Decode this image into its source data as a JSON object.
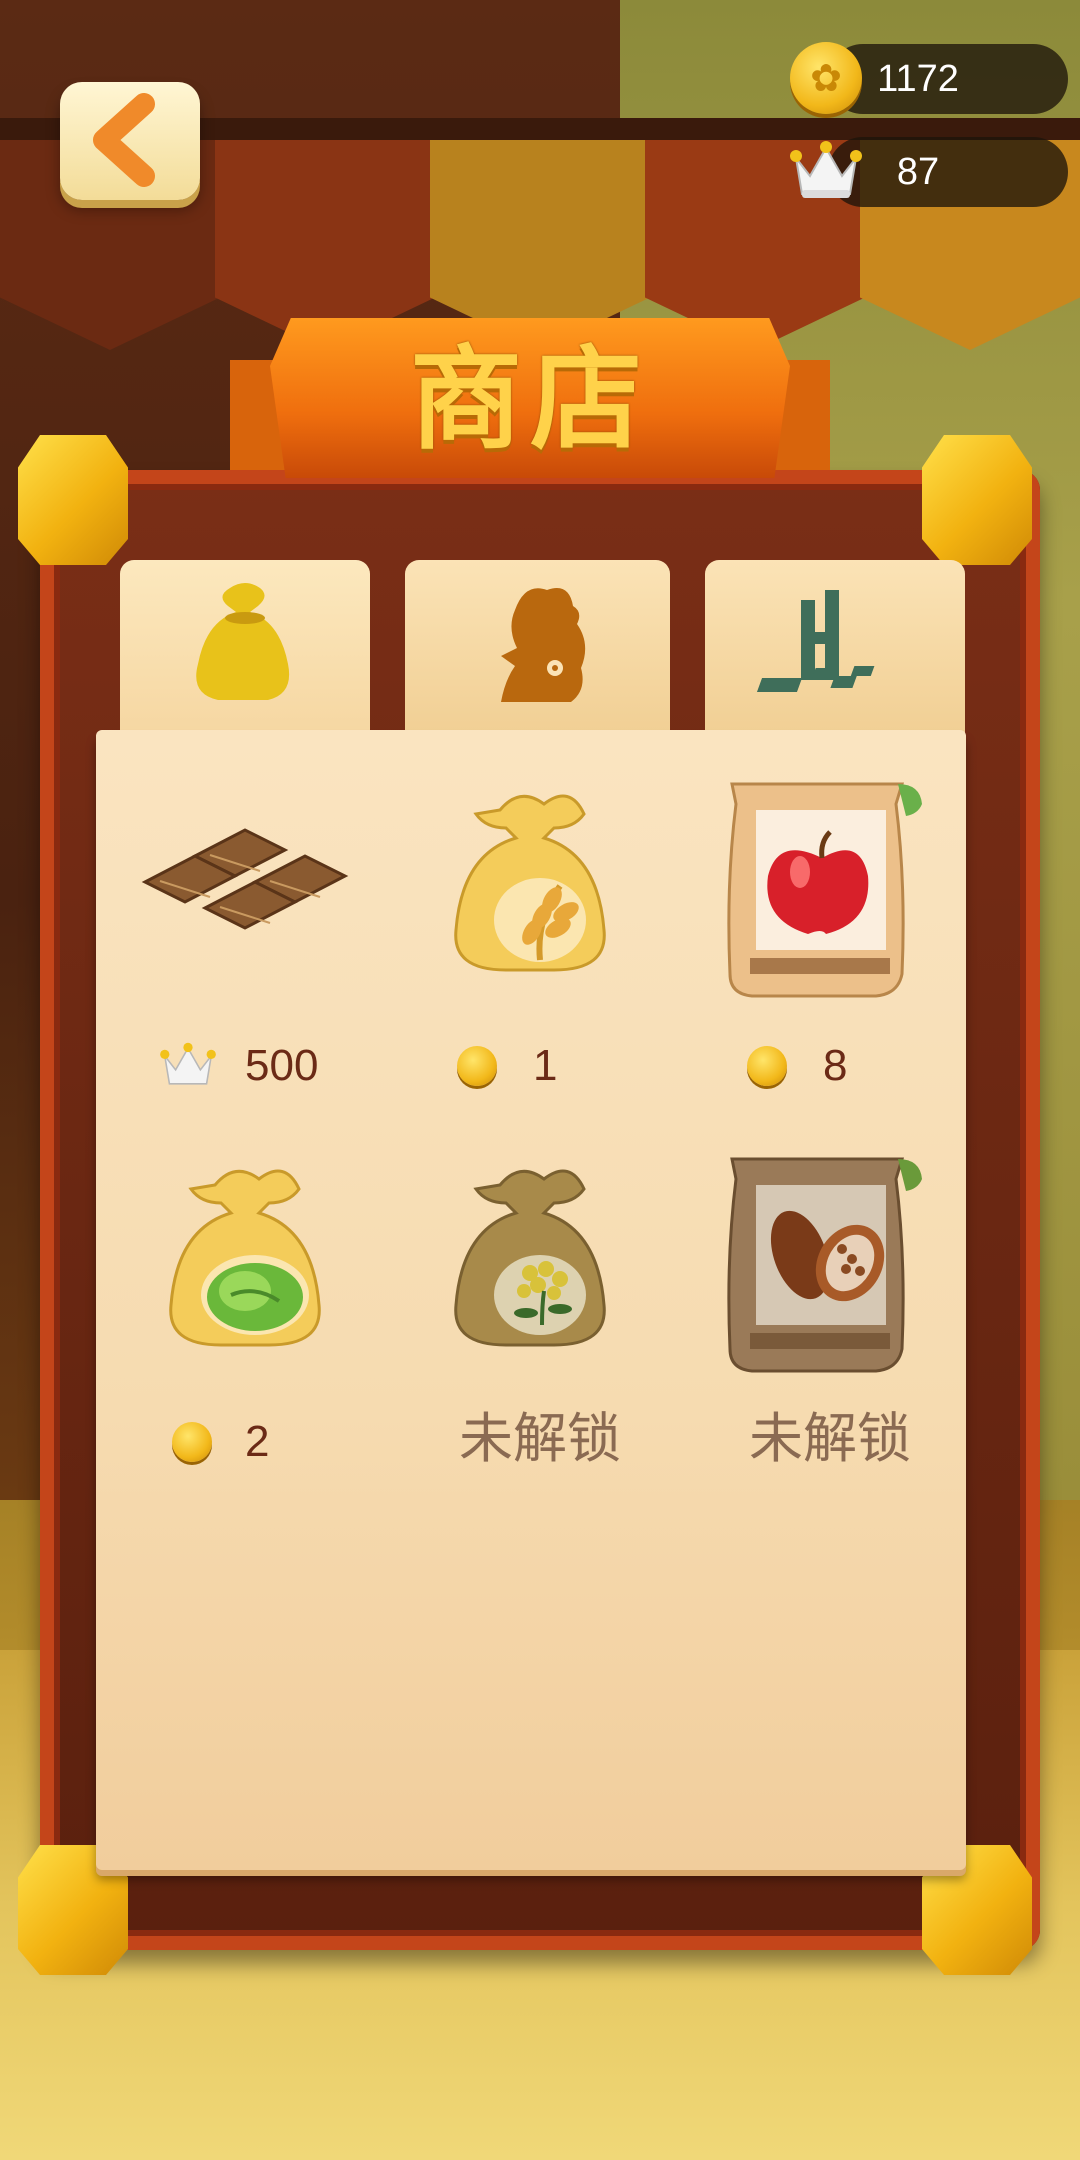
{
  "title": "商店",
  "currency": {
    "coins": "1172",
    "crowns": "87"
  },
  "tabs": [
    {
      "icon": "seed-bag-icon",
      "active": true
    },
    {
      "icon": "chicken-icon",
      "active": false
    },
    {
      "icon": "farmland-icon",
      "active": false
    }
  ],
  "items": [
    {
      "name": "farmland-plots",
      "currency": "crown",
      "price": "500",
      "locked": false
    },
    {
      "name": "wheat-seed-bag",
      "currency": "coin",
      "price": "1",
      "locked": false
    },
    {
      "name": "apple-seed-bag",
      "currency": "coin",
      "price": "8",
      "locked": false
    },
    {
      "name": "cabbage-seed-bag",
      "currency": "coin",
      "price": "2",
      "locked": false
    },
    {
      "name": "rapeseed-seed-bag",
      "locked": true,
      "status": "未解锁"
    },
    {
      "name": "cocoa-seed-bag",
      "locked": true,
      "status": "未解锁"
    }
  ],
  "colors": {
    "accent": "#ef6e0e",
    "title_text": "#ffd24a",
    "price_text": "#6b2a16",
    "locked_text": "#8a6a52"
  }
}
